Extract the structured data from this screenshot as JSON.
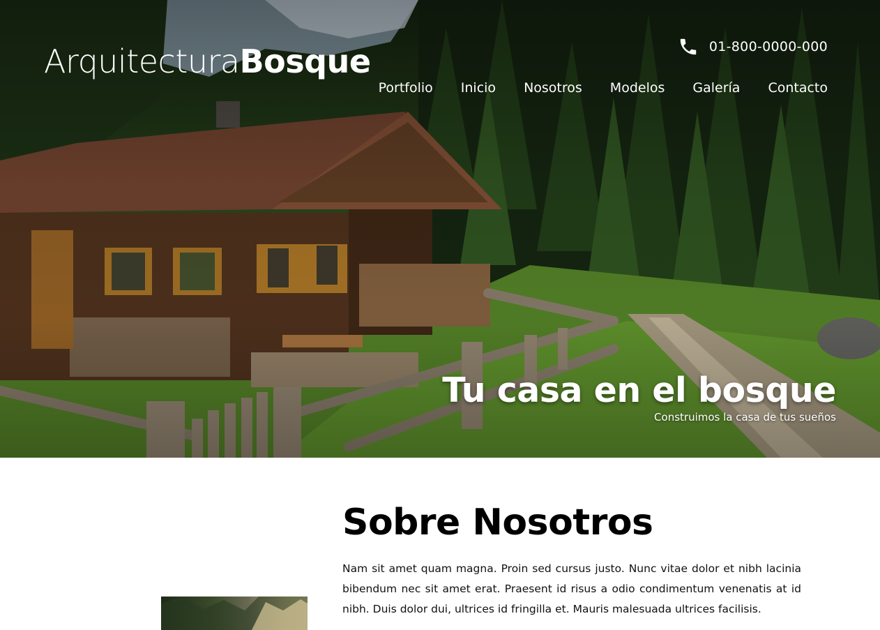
{
  "brand": {
    "name_light": "Arquitectura",
    "name_bold": "Bosque"
  },
  "contact": {
    "phone_icon": "phone-icon",
    "phone": "01-800-0000-000"
  },
  "nav": {
    "items": [
      {
        "label": "Portfolio"
      },
      {
        "label": "Inicio"
      },
      {
        "label": "Nosotros"
      },
      {
        "label": "Modelos"
      },
      {
        "label": "Galería"
      },
      {
        "label": "Contacto"
      }
    ]
  },
  "hero": {
    "title": "Tu casa en el bosque",
    "subtitle": "Construimos la casa de tus sueños",
    "image": "forest-cabin-photo"
  },
  "about": {
    "title": "Sobre Nosotros",
    "text": "Nam sit amet quam magna. Proin sed cursus justo. Nunc vitae dolor et nibh lacinia bibendum nec sit amet erat. Praesent id risus a odio condimentum venenatis at id nibh. Duis dolor dui, ultrices id fringilla et. Mauris malesuada ultrices facilisis.",
    "image": "forest-photo"
  },
  "colors": {
    "text_on_hero": "#ffffff",
    "heading": "#000000",
    "body_text": "#111111",
    "background": "#ffffff"
  }
}
